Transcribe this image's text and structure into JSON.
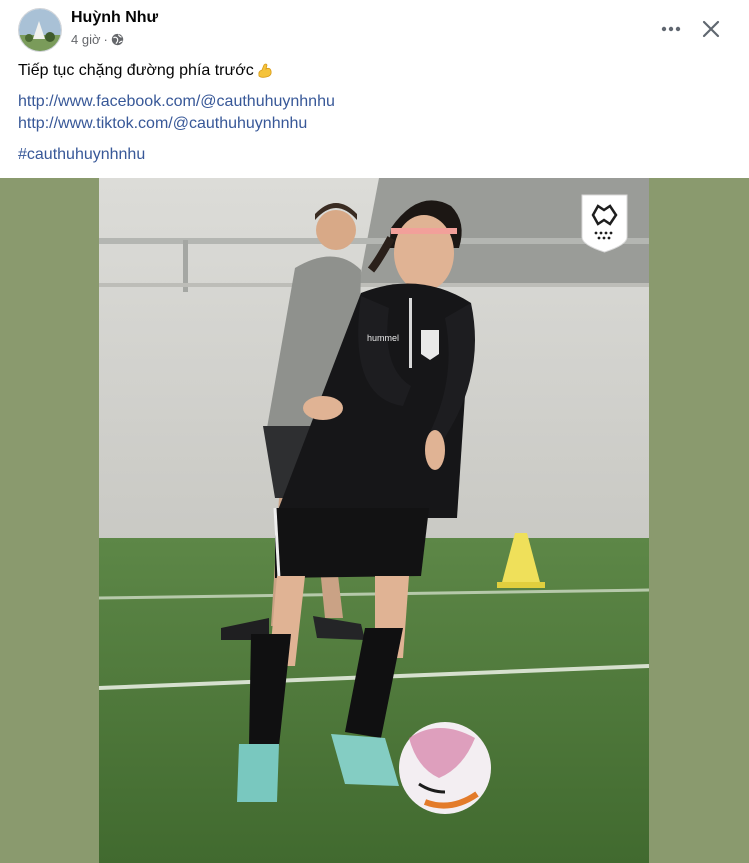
{
  "post": {
    "author": "Huỳnh Như",
    "time": "4 giờ",
    "separator": "·",
    "privacy_icon": "globe-icon",
    "caption": "Tiếp tục chặng đường phía trước",
    "caption_emoji": "flexed-biceps-emoji",
    "links": [
      "http://www.facebook.com/@cauthuhuynhnhu",
      "http://www.tiktok.com/@cauthuhuynhnhu"
    ],
    "hashtag": "#cauthuhuynhnhu"
  },
  "controls": {
    "more_icon": "more-options-icon",
    "close_icon": "close-icon"
  },
  "photo": {
    "jersey_brand": "hummel",
    "club_logo": "club-crest-logo"
  },
  "colors": {
    "link": "#385898",
    "secondary_text": "#65676b",
    "photo_backdrop": "#8a9a6e",
    "pitch": "#4f7a3a",
    "cone": "#f2e34a"
  }
}
